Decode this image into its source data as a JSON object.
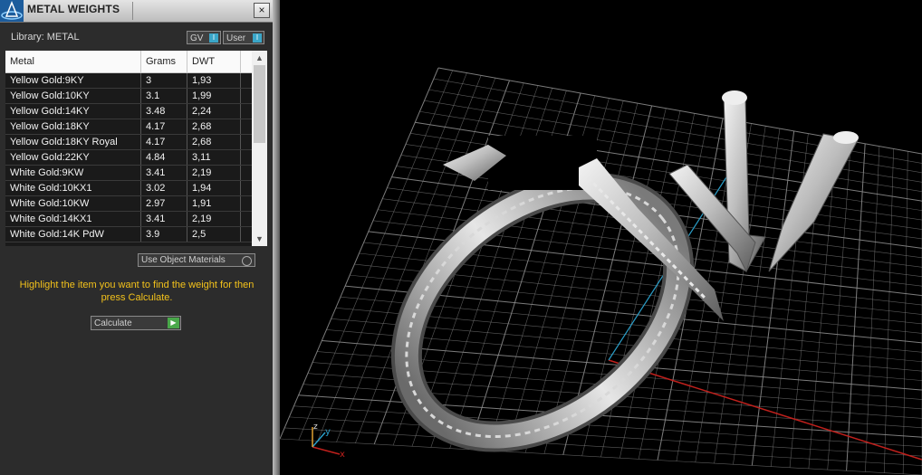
{
  "panel": {
    "title": "METAL WEIGHTS",
    "close_label": "×",
    "library_label": "Library: METAL",
    "toggles": [
      {
        "label": "GV",
        "knob": "I"
      },
      {
        "label": "User",
        "knob": "I"
      }
    ],
    "columns": [
      "Metal",
      "Grams",
      "DWT"
    ],
    "rows": [
      [
        "Yellow Gold:9KY",
        "3",
        "1,93"
      ],
      [
        "Yellow Gold:10KY",
        "3.1",
        "1,99"
      ],
      [
        "Yellow Gold:14KY",
        "3.48",
        "2,24"
      ],
      [
        "Yellow Gold:18KY",
        "4.17",
        "2,68"
      ],
      [
        "Yellow Gold:18KY Royal",
        "4.17",
        "2,68"
      ],
      [
        "Yellow Gold:22KY",
        "4.84",
        "3,11"
      ],
      [
        "White Gold:9KW",
        "3.41",
        "2,19"
      ],
      [
        "White Gold:10KX1",
        "3.02",
        "1,94"
      ],
      [
        "White Gold:10KW",
        "2.97",
        "1,91"
      ],
      [
        "White Gold:14KX1",
        "3.41",
        "2,19"
      ],
      [
        "White Gold:14K PdW",
        "3.9",
        "2,5"
      ]
    ],
    "use_object_materials": "Use Object Materials",
    "instructions": "Highlight the item you want to find the weight for then press Calculate.",
    "calculate_label": "Calculate",
    "scroll_up": "▲",
    "scroll_down": "▼",
    "calc_arrow": "▶"
  },
  "viewport": {
    "axis_labels": {
      "x": "x",
      "y": "y",
      "z": "z"
    },
    "colors": {
      "x_axis": "#c0201c",
      "y_axis": "#2a9ec8",
      "grid": "#8a8a8a",
      "background": "#000000"
    }
  }
}
